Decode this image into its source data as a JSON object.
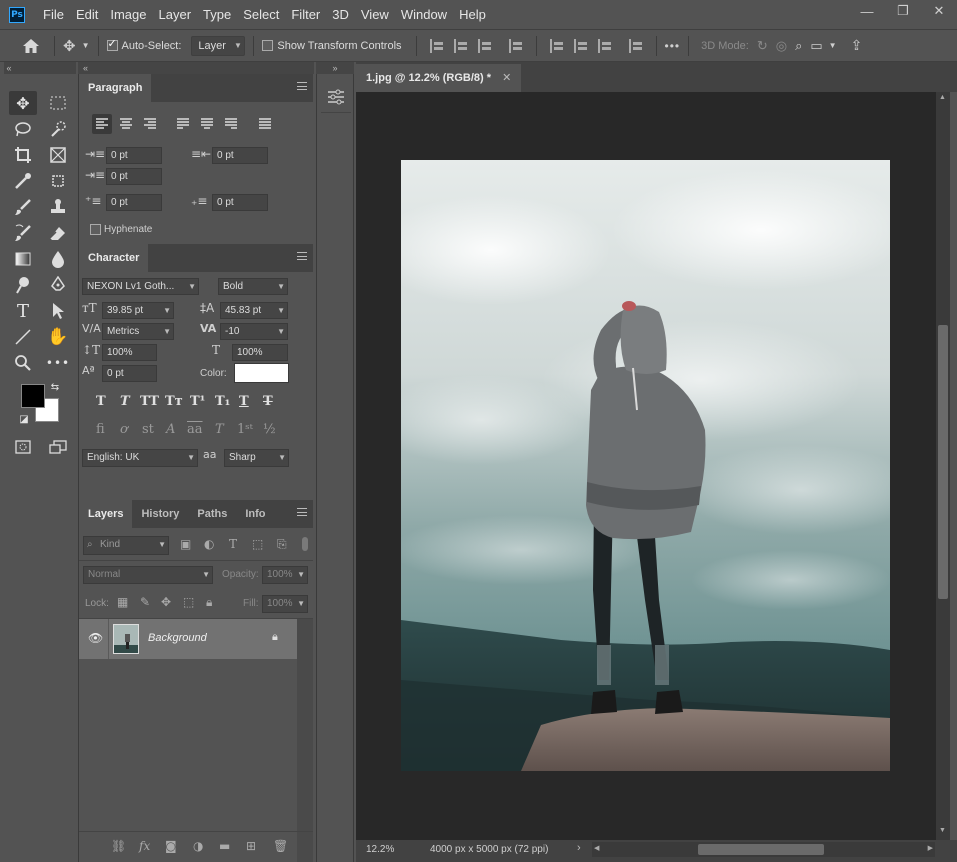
{
  "menubar": {
    "logo": "Ps",
    "items": [
      "File",
      "Edit",
      "Image",
      "Layer",
      "Type",
      "Select",
      "Filter",
      "3D",
      "View",
      "Window",
      "Help"
    ],
    "win_minimize": "—",
    "win_restore": "❐",
    "win_close": "✕"
  },
  "options": {
    "auto_select_label": "Auto-Select:",
    "auto_select_checked": true,
    "auto_select_target": "Layer",
    "show_transform_label": "Show Transform Controls",
    "show_transform_checked": false,
    "more_label": "•••",
    "mode_3d_label": "3D Mode:"
  },
  "paragraph": {
    "tab_label": "Paragraph",
    "indent_left": "0 pt",
    "indent_right": "0 pt",
    "indent_first": "0 pt",
    "space_before": "0 pt",
    "space_after": "0 pt",
    "hyphenate_label": "Hyphenate"
  },
  "character": {
    "tab_label": "Character",
    "font_family": "NEXON Lv1 Goth...",
    "font_style": "Bold",
    "font_size": "39.85 pt",
    "leading": "45.83 pt",
    "kerning": "Metrics",
    "tracking": "-10",
    "vertical_scale": "100%",
    "horizontal_scale": "100%",
    "baseline_shift": "0 pt",
    "color_label": "Color:",
    "color_value": "#ffffff",
    "language": "English: UK",
    "aa_icon": "aa",
    "antialias": "Sharp"
  },
  "layers": {
    "tabs": [
      "Layers",
      "History",
      "Paths",
      "Info"
    ],
    "filter_placeholder": "Kind",
    "blend_mode": "Normal",
    "opacity_label": "Opacity:",
    "opacity_value": "100%",
    "lock_label": "Lock:",
    "fill_label": "Fill:",
    "fill_value": "100%",
    "items": [
      {
        "name": "Background",
        "visible": true,
        "locked": true
      }
    ]
  },
  "document": {
    "tab_title": "1.jpg @ 12.2% (RGB/8) *",
    "zoom": "12.2%",
    "doc_info": "4000 px x 5000 px (72 ppi)"
  },
  "colors": {
    "foreground": "#000000",
    "background": "#ffffff",
    "chrome": "#535353",
    "canvas_bg": "#282828"
  }
}
